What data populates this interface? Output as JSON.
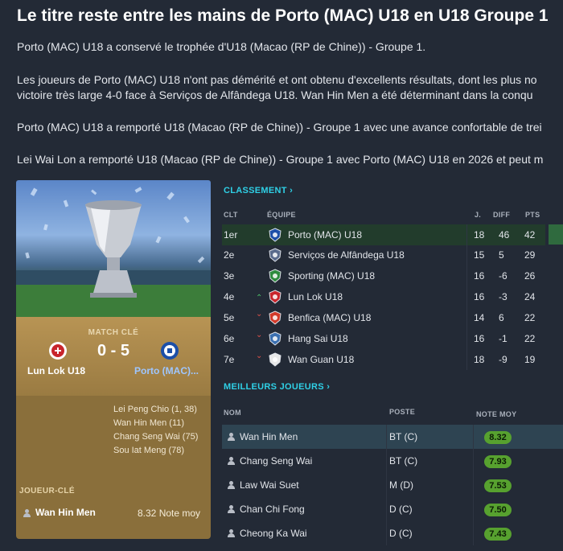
{
  "headline": "Le titre reste entre les mains de Porto (MAC) U18 en U18 Groupe 1",
  "paragraphs": [
    "Porto (MAC) U18 a conservé le trophée d'U18 (Macao (RP de Chine)) - Groupe 1.",
    "Les joueurs de Porto (MAC) U18 n'ont pas démérité et ont obtenu d'excellents résultats, dont les plus no",
    "victoire très large 4-0 face à Serviços de Alfândega U18. Wan Hin Men a été déterminant dans la conqu",
    "Porto (MAC) U18 a remporté U18 (Macao (RP de Chine)) - Groupe 1 avec une avance confortable de trei",
    "Lei Wai Lon a remporté U18 (Macao (RP de Chine)) - Groupe 1 avec Porto (MAC) U18 en 2026 et peut m"
  ],
  "match": {
    "label": "MATCH CLÉ",
    "score": "0 - 5",
    "home": "Lun Lok U18",
    "away": "Porto (MAC)...",
    "scorers": [
      "Lei Peng Chio (1, 38)",
      "Wan Hin Men (11)",
      "Chang Seng Wai (75)",
      "Sou Iat Meng (78)"
    ],
    "key_player_label": "JOUEUR-CLÉ",
    "key_player_name": "Wan Hin Men",
    "key_player_note": "8.32 Note moy"
  },
  "standings": {
    "title": "CLASSEMENT",
    "headers": {
      "pos": "CLT",
      "team": "ÉQUIPE",
      "played": "J.",
      "diff": "DIFF",
      "pts": "PTS"
    },
    "rows": [
      {
        "pos": "1er",
        "team": "Porto (MAC) U18",
        "played": "18",
        "diff": "46",
        "pts": "42",
        "trend": "",
        "color": "#1c4fa8"
      },
      {
        "pos": "2e",
        "team": "Serviços de Alfândega U18",
        "played": "15",
        "diff": "5",
        "pts": "29",
        "trend": "",
        "color": "#5a6b8c"
      },
      {
        "pos": "3e",
        "team": "Sporting (MAC) U18",
        "played": "16",
        "diff": "-6",
        "pts": "26",
        "trend": "",
        "color": "#2e8b3e"
      },
      {
        "pos": "4e",
        "team": "Lun Lok U18",
        "played": "16",
        "diff": "-3",
        "pts": "24",
        "trend": "up",
        "color": "#c8252c"
      },
      {
        "pos": "5e",
        "team": "Benfica (MAC) U18",
        "played": "14",
        "diff": "6",
        "pts": "22",
        "trend": "down",
        "color": "#d23a2a"
      },
      {
        "pos": "6e",
        "team": "Hang Sai U18",
        "played": "16",
        "diff": "-1",
        "pts": "22",
        "trend": "down",
        "color": "#3a6fb0"
      },
      {
        "pos": "7e",
        "team": "Wan Guan U18",
        "played": "18",
        "diff": "-9",
        "pts": "19",
        "trend": "down",
        "color": "#e8e8e8"
      }
    ]
  },
  "players": {
    "title": "MEILLEURS JOUEURS",
    "headers": {
      "name": "NOM",
      "pos": "POSTE",
      "rating": "NOTE MOY"
    },
    "rows": [
      {
        "name": "Wan Hin Men",
        "pos": "BT (C)",
        "rating": "8.32"
      },
      {
        "name": "Chang Seng Wai",
        "pos": "BT (C)",
        "rating": "7.93"
      },
      {
        "name": "Law Wai Suet",
        "pos": "M (D)",
        "rating": "7.53"
      },
      {
        "name": "Chan Chi Fong",
        "pos": "D (C)",
        "rating": "7.50"
      },
      {
        "name": "Cheong Ka Wai",
        "pos": "D (C)",
        "rating": "7.43"
      }
    ]
  },
  "colors": {
    "accent": "#2fd0e6",
    "rating": "#57a12f",
    "highlight": "#223c2c",
    "up": "#4cc36a",
    "down": "#e0524a"
  }
}
